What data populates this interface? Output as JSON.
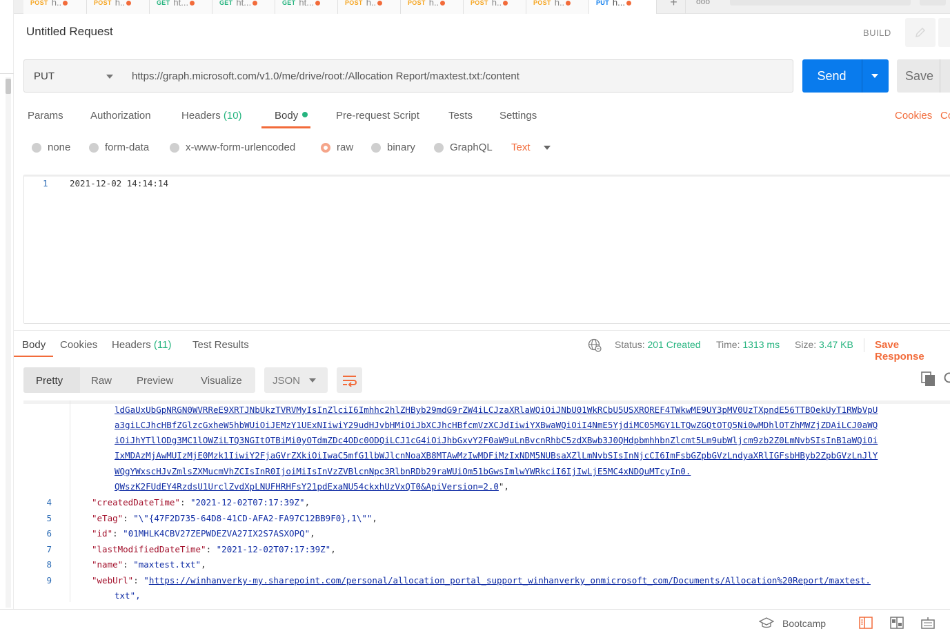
{
  "tabs": [
    {
      "method": "POST",
      "name": "h..",
      "method_color": "#f6a623"
    },
    {
      "method": "POST",
      "name": "h..",
      "method_color": "#f6a623"
    },
    {
      "method": "GET",
      "name": "ht...",
      "method_color": "#26b47f"
    },
    {
      "method": "GET",
      "name": "ht...",
      "method_color": "#26b47f"
    },
    {
      "method": "GET",
      "name": "ht...",
      "method_color": "#26b47f"
    },
    {
      "method": "POST",
      "name": "h..",
      "method_color": "#f6a623"
    },
    {
      "method": "POST",
      "name": "h..",
      "method_color": "#f6a623"
    },
    {
      "method": "POST",
      "name": "h..",
      "method_color": "#f6a623"
    },
    {
      "method": "POST",
      "name": "h..",
      "method_color": "#f6a623"
    },
    {
      "method": "PUT",
      "name": "h...",
      "method_color": "#097bed"
    }
  ],
  "tab_plus": "+",
  "tab_more": "ooo",
  "request": {
    "title": "Untitled Request",
    "build_label": "BUILD",
    "method": "PUT",
    "url": "https://graph.microsoft.com/v1.0/me/drive/root:/Allocation Report/maxtest.txt:/content",
    "send_label": "Send",
    "save_label": "Save"
  },
  "request_tabs": {
    "params": "Params",
    "authorization": "Authorization",
    "headers": "Headers",
    "headers_count": "(10)",
    "body": "Body",
    "prerequest": "Pre-request Script",
    "tests": "Tests",
    "settings": "Settings",
    "cookies": "Cookies",
    "code": "Co"
  },
  "body_types": {
    "none": "none",
    "form_data": "form-data",
    "urlencoded": "x-www-form-urlencoded",
    "raw": "raw",
    "binary": "binary",
    "graphql": "GraphQL",
    "text_type": "Text"
  },
  "editor": {
    "line_no": "1",
    "text": "2021-12-02 14:14:14"
  },
  "response_tabs": {
    "body": "Body",
    "cookies": "Cookies",
    "headers": "Headers",
    "headers_count": "(11)",
    "test_results": "Test Results"
  },
  "response_meta": {
    "status_label": "Status:",
    "status_value": "201 Created",
    "time_label": "Time:",
    "time_value": "1313 ms",
    "size_label": "Size:",
    "size_value": "3.47 KB",
    "save_response": "Save Response"
  },
  "format_toolbar": {
    "pretty": "Pretty",
    "raw": "Raw",
    "preview": "Preview",
    "visualize": "Visualize",
    "json": "JSON"
  },
  "response_code": {
    "wrapped_lines": [
      "ldGaUxUbGpNRGN0WVRReE9XRTJNbUkzTVRVMyIsInZlciI6Imhhc2hlZHByb29mdG9rZW4iLCJzaXRlaWQiOiJNbU01WkRCbU5USXROREF4TWkwME9UY3pMV0UzTXpndE56TTBOekUyT1RWbVpU",
      "a3giLCJhcHBfZGlzcGxheW5hbWUiOiJEMzY1UExNIiwiY29udHJvbHMiOiJbXCJhcHBfcmVzXCJdIiwiYXBwaWQiOiI4NmE5YjdiMC05MGY1LTQwZGQtOTQ5Ni0wMDhlOTZhMWZjZDAiLCJ0aWQ",
      "iOiJhYTllODg3MC1lOWZiLTQ3NGItOTBiMi0yOTdmZDc4ODc0ODQiLCJ1cG4iOiJhbGxvY2F0aW9uLnBvcnRhbC5zdXBwb3J0QHdpbmhhbnZlcmt5Lm9ubWljcm9zb2Z0LmNvbSIsInB1aWQiOi",
      "IxMDAzMjAwMUIzMjE0Mzk1IiwiY2FjaGVrZXkiOiIwaC5mfG1lbWJlcnNoaXB8MTAwMzIwMDFiMzIxNDM5NUBsaXZlLmNvbSIsInNjcCI6ImFsbGZpbGVzLndyaXRlIGFsbHByb2ZpbGVzLnJlY",
      "WQgYWxscHJvZmlsZXMucmVhZCIsInR0IjoiMiIsInVzZVBlcnNpc3RlbnRDb29raWUiOm51bGwsImlwYWRkciI6IjIwLjE5MC4xNDQuMTcyIn0.",
      "QWszK2FUdEY4RzdsU1UrclZvdXpLNUFHRHFsY21pdExaNU54ckxhUzVxQT0&ApiVersion=2.0"
    ],
    "wrapped_suffix": "\",",
    "lines": [
      {
        "no": "4",
        "key": "\"createdDateTime\"",
        "value": "\"2021-12-02T07:17:39Z\""
      },
      {
        "no": "5",
        "key": "\"eTag\"",
        "value": "\"\\\"{47F2D735-64D8-41CD-AFA2-FA97C12BB9F0},1\\\"\""
      },
      {
        "no": "6",
        "key": "\"id\"",
        "value": "\"01MHLK4CBV27ZEPWDEZVA27IX2S7ASXOPQ\""
      },
      {
        "no": "7",
        "key": "\"lastModifiedDateTime\"",
        "value": "\"2021-12-02T07:17:39Z\""
      },
      {
        "no": "8",
        "key": "\"name\"",
        "value": "\"maxtest.txt\""
      }
    ],
    "weburl_no": "9",
    "weburl_key": "\"webUrl\"",
    "weburl_link": "https://winhanverky-my.sharepoint.com/personal/allocation_portal_support_winhanverky_onmicrosoft_com/Documents/Allocation%20Report/maxtest.",
    "weburl_wrap": "txt\","
  },
  "bottom": {
    "bootcamp": "Bootcamp"
  },
  "colors": {
    "accent_orange": "#f26b3a",
    "send_blue": "#097bed",
    "status_green": "#26b47f"
  }
}
